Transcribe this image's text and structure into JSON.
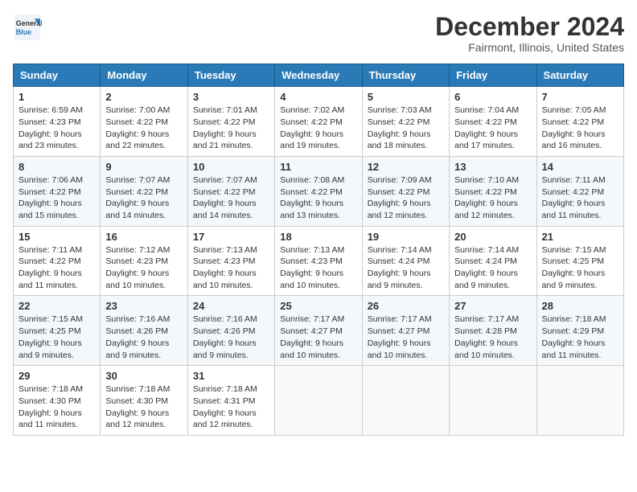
{
  "header": {
    "logo_general": "General",
    "logo_blue": "Blue",
    "month_title": "December 2024",
    "location": "Fairmont, Illinois, United States"
  },
  "days_of_week": [
    "Sunday",
    "Monday",
    "Tuesday",
    "Wednesday",
    "Thursday",
    "Friday",
    "Saturday"
  ],
  "weeks": [
    [
      {
        "day": "1",
        "sunrise": "6:59 AM",
        "sunset": "4:23 PM",
        "daylight": "9 hours and 23 minutes."
      },
      {
        "day": "2",
        "sunrise": "7:00 AM",
        "sunset": "4:22 PM",
        "daylight": "9 hours and 22 minutes."
      },
      {
        "day": "3",
        "sunrise": "7:01 AM",
        "sunset": "4:22 PM",
        "daylight": "9 hours and 21 minutes."
      },
      {
        "day": "4",
        "sunrise": "7:02 AM",
        "sunset": "4:22 PM",
        "daylight": "9 hours and 19 minutes."
      },
      {
        "day": "5",
        "sunrise": "7:03 AM",
        "sunset": "4:22 PM",
        "daylight": "9 hours and 18 minutes."
      },
      {
        "day": "6",
        "sunrise": "7:04 AM",
        "sunset": "4:22 PM",
        "daylight": "9 hours and 17 minutes."
      },
      {
        "day": "7",
        "sunrise": "7:05 AM",
        "sunset": "4:22 PM",
        "daylight": "9 hours and 16 minutes."
      }
    ],
    [
      {
        "day": "8",
        "sunrise": "7:06 AM",
        "sunset": "4:22 PM",
        "daylight": "9 hours and 15 minutes."
      },
      {
        "day": "9",
        "sunrise": "7:07 AM",
        "sunset": "4:22 PM",
        "daylight": "9 hours and 14 minutes."
      },
      {
        "day": "10",
        "sunrise": "7:07 AM",
        "sunset": "4:22 PM",
        "daylight": "9 hours and 14 minutes."
      },
      {
        "day": "11",
        "sunrise": "7:08 AM",
        "sunset": "4:22 PM",
        "daylight": "9 hours and 13 minutes."
      },
      {
        "day": "12",
        "sunrise": "7:09 AM",
        "sunset": "4:22 PM",
        "daylight": "9 hours and 12 minutes."
      },
      {
        "day": "13",
        "sunrise": "7:10 AM",
        "sunset": "4:22 PM",
        "daylight": "9 hours and 12 minutes."
      },
      {
        "day": "14",
        "sunrise": "7:11 AM",
        "sunset": "4:22 PM",
        "daylight": "9 hours and 11 minutes."
      }
    ],
    [
      {
        "day": "15",
        "sunrise": "7:11 AM",
        "sunset": "4:22 PM",
        "daylight": "9 hours and 11 minutes."
      },
      {
        "day": "16",
        "sunrise": "7:12 AM",
        "sunset": "4:23 PM",
        "daylight": "9 hours and 10 minutes."
      },
      {
        "day": "17",
        "sunrise": "7:13 AM",
        "sunset": "4:23 PM",
        "daylight": "9 hours and 10 minutes."
      },
      {
        "day": "18",
        "sunrise": "7:13 AM",
        "sunset": "4:23 PM",
        "daylight": "9 hours and 10 minutes."
      },
      {
        "day": "19",
        "sunrise": "7:14 AM",
        "sunset": "4:24 PM",
        "daylight": "9 hours and 9 minutes."
      },
      {
        "day": "20",
        "sunrise": "7:14 AM",
        "sunset": "4:24 PM",
        "daylight": "9 hours and 9 minutes."
      },
      {
        "day": "21",
        "sunrise": "7:15 AM",
        "sunset": "4:25 PM",
        "daylight": "9 hours and 9 minutes."
      }
    ],
    [
      {
        "day": "22",
        "sunrise": "7:15 AM",
        "sunset": "4:25 PM",
        "daylight": "9 hours and 9 minutes."
      },
      {
        "day": "23",
        "sunrise": "7:16 AM",
        "sunset": "4:26 PM",
        "daylight": "9 hours and 9 minutes."
      },
      {
        "day": "24",
        "sunrise": "7:16 AM",
        "sunset": "4:26 PM",
        "daylight": "9 hours and 9 minutes."
      },
      {
        "day": "25",
        "sunrise": "7:17 AM",
        "sunset": "4:27 PM",
        "daylight": "9 hours and 10 minutes."
      },
      {
        "day": "26",
        "sunrise": "7:17 AM",
        "sunset": "4:27 PM",
        "daylight": "9 hours and 10 minutes."
      },
      {
        "day": "27",
        "sunrise": "7:17 AM",
        "sunset": "4:28 PM",
        "daylight": "9 hours and 10 minutes."
      },
      {
        "day": "28",
        "sunrise": "7:18 AM",
        "sunset": "4:29 PM",
        "daylight": "9 hours and 11 minutes."
      }
    ],
    [
      {
        "day": "29",
        "sunrise": "7:18 AM",
        "sunset": "4:30 PM",
        "daylight": "9 hours and 11 minutes."
      },
      {
        "day": "30",
        "sunrise": "7:18 AM",
        "sunset": "4:30 PM",
        "daylight": "9 hours and 12 minutes."
      },
      {
        "day": "31",
        "sunrise": "7:18 AM",
        "sunset": "4:31 PM",
        "daylight": "9 hours and 12 minutes."
      },
      null,
      null,
      null,
      null
    ]
  ],
  "labels": {
    "sunrise": "Sunrise:",
    "sunset": "Sunset:",
    "daylight": "Daylight:"
  }
}
